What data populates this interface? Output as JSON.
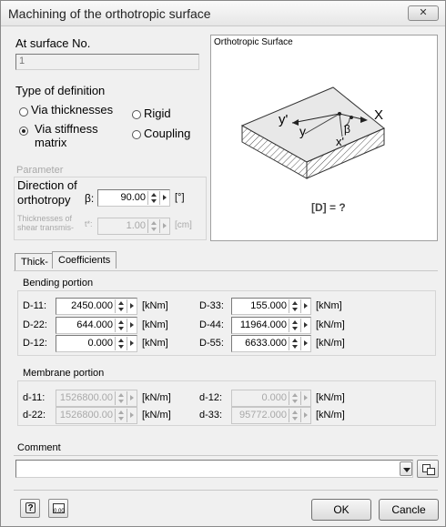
{
  "window": {
    "title": "Machining of the orthotropic surface",
    "close_glyph": "✕"
  },
  "surface": {
    "label": "At surface No.",
    "value": "1"
  },
  "definition": {
    "label": "Type of definition",
    "options": [
      "Via thicknesses",
      "Via stiffness",
      "Rigid",
      "Coupling"
    ],
    "stiffness_line2": "matrix",
    "selected": "Via stiffness matrix"
  },
  "parameter": {
    "label": "Parameter",
    "direction_line1": "Direction of",
    "direction_line2": "orthotropy",
    "beta_symbol": "β:",
    "beta_value": "90.00",
    "beta_unit": "[°]",
    "shear_line1": "Thicknesses of",
    "shear_line2": "shear transmis-",
    "shear_symbol": "t*:",
    "shear_value": "1.00",
    "shear_unit": "[cm]"
  },
  "preview": {
    "title": "Orthotropic Surface",
    "axes": [
      "y'",
      "y",
      "β",
      "X",
      "x'"
    ],
    "formula": "[D] = ?"
  },
  "tabs": [
    "Thick-",
    "Coefficients"
  ],
  "bending": {
    "label": "Bending portion",
    "left": [
      {
        "name": "D-11:",
        "value": "2450.000",
        "unit": "[kNm]"
      },
      {
        "name": "D-22:",
        "value": "644.000",
        "unit": "[kNm]"
      },
      {
        "name": "D-12:",
        "value": "0.000",
        "unit": "[kNm]"
      }
    ],
    "right": [
      {
        "name": "D-33:",
        "value": "155.000",
        "unit": "[kNm]"
      },
      {
        "name": "D-44:",
        "value": "11964.000",
        "unit": "[kN/m]"
      },
      {
        "name": "D-55:",
        "value": "6633.000",
        "unit": "[kN/m]"
      }
    ]
  },
  "membrane": {
    "label": "Membrane portion",
    "left": [
      {
        "name": "d-11:",
        "value": "1526800.00",
        "unit": "[kN/m]"
      },
      {
        "name": "d-22:",
        "value": "1526800.00",
        "unit": "[kN/m]"
      }
    ],
    "right": [
      {
        "name": "d-12:",
        "value": "0.000",
        "unit": "[kN/m]"
      },
      {
        "name": "d-33:",
        "value": "95772.000",
        "unit": "[kN/m]"
      }
    ]
  },
  "comment": {
    "label": "Comment",
    "value": ""
  },
  "buttons": {
    "ok": "OK",
    "cancel": "Cancle"
  },
  "icons": {
    "help": "help-icon",
    "units": "units-icon",
    "copy": "copy-icon"
  }
}
